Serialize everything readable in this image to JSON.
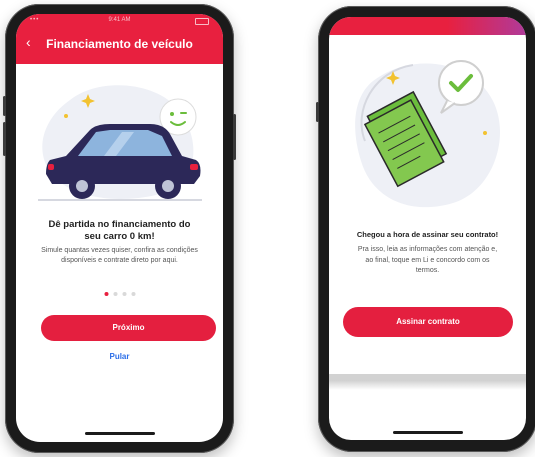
{
  "colors": {
    "brand_red": "#e8203f",
    "link_blue": "#2b6ee8",
    "accent_green": "#6bbd3c"
  },
  "left_screen": {
    "header": {
      "title": "Financiamento de veículo",
      "back_icon": "chevron-left-icon"
    },
    "status_bar": {
      "time": "9:41 AM"
    },
    "heading": "Dê partida no financiamento do seu carro 0 km!",
    "description": "Simule quantas vezes quiser, confira as condições disponíveis e contrate direto por aqui.",
    "pagination": {
      "total": 4,
      "current": 1
    },
    "primary_button": "Próximo",
    "skip_link": "Pular"
  },
  "right_screen": {
    "heading": "Chegou a hora de assinar seu contrato!",
    "description": "Pra isso, leia as informações com atenção e, ao final, toque em Li e concordo com os termos.",
    "primary_button": "Assinar contrato"
  }
}
